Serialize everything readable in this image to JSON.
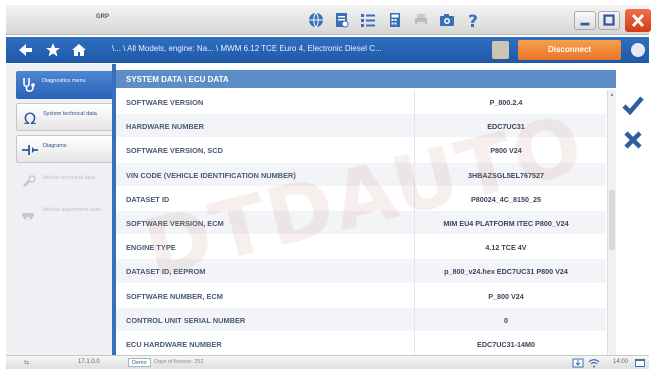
{
  "toolbar": {
    "grp_label": "GRP",
    "icons": [
      "globe-icon",
      "report-icon",
      "list-icon",
      "calculator-icon",
      "print-icon",
      "camera-icon",
      "help-icon"
    ],
    "window_controls": [
      "minimize-icon",
      "maximize-icon",
      "close-icon"
    ]
  },
  "nav": {
    "breadcrumb": "\\... \\ All Models, engine: Na...  \\ MWM 6.12 TCE Euro 4, Electronic Diesel C...",
    "disconnect_label": "Disconnect",
    "icons": [
      "back-arrow-icon",
      "star-icon",
      "home-icon",
      "document-icon",
      "menu-dot-icon"
    ]
  },
  "sidebar": {
    "items": [
      {
        "label": "Diagnostics menu",
        "icon": "stethoscope-icon",
        "state": "active"
      },
      {
        "label": "System technical data",
        "icon": "ohm-icon",
        "state": "normal"
      },
      {
        "label": "Diagrams",
        "icon": "diagram-icon",
        "state": "normal"
      },
      {
        "label": "Vehicle technical data",
        "icon": "car-wrench-icon",
        "state": "disabled"
      },
      {
        "label": "Vehicle adjustment data",
        "icon": "car-adjust-icon",
        "state": "disabled"
      }
    ]
  },
  "main": {
    "title": "SYSTEM DATA \\ ECU DATA",
    "rows": [
      {
        "label": "SOFTWARE VERSION",
        "value": "P_800.2.4"
      },
      {
        "label": "HARDWARE NUMBER",
        "value": "EDC7UC31"
      },
      {
        "label": "SOFTWARE VERSION, SCD",
        "value": "P800 V24"
      },
      {
        "label": "VIN CODE (VEHICLE IDENTIFICATION NUMBER)",
        "value": "3HBAZSGL5EL767527"
      },
      {
        "label": "DATASET ID",
        "value": "P80024_4C_8150_25"
      },
      {
        "label": "SOFTWARE VERSION, ECM",
        "value": "MIM EU4 PLATFORM ITEC P800_V24"
      },
      {
        "label": "ENGINE TYPE",
        "value": "4.12 TCE 4V"
      },
      {
        "label": "DATASET ID, EEPROM",
        "value": "p_800_v24.hex EDC7UC31 P800 V24"
      },
      {
        "label": "SOFTWARE NUMBER, ECM",
        "value": "P_800 V24"
      },
      {
        "label": "CONTROL UNIT SERIAL NUMBER",
        "value": "0"
      },
      {
        "label": "ECU HARDWARE NUMBER",
        "value": "EDC7UC31-14M0"
      }
    ]
  },
  "actions": {
    "icons": [
      "checkmark-icon",
      "cancel-x-icon"
    ],
    "colors": {
      "primary": "#2d5e9e"
    }
  },
  "watermark": "DTDAUTO",
  "status": {
    "version": "17.1.0.0",
    "demo_label": "Demo",
    "days_text": "Days of licence: 252",
    "time": "14:00"
  },
  "colors": {
    "nav_blue": "#2a64b4",
    "disconnect_orange": "#ef8a36",
    "close_red": "#e04f22",
    "header_blue": "#5d8dc7"
  }
}
